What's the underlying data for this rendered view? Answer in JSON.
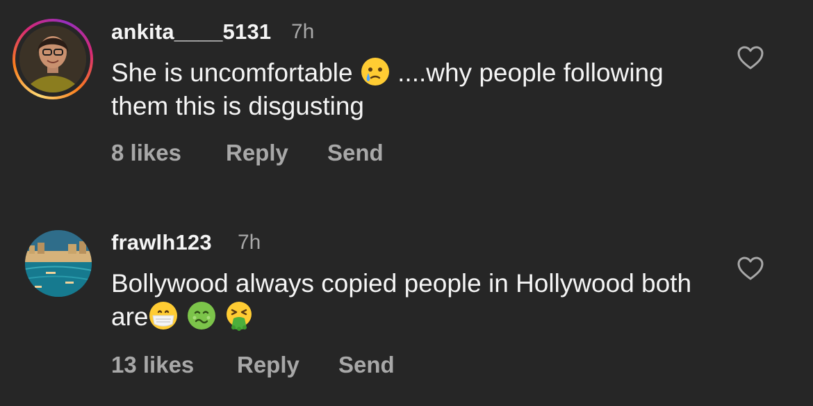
{
  "comments": [
    {
      "username": "ankita____5131",
      "time": "7h",
      "text_before": "She is uncomfortable ",
      "emoji_1": "face-holding-back-tears",
      "text_after": " ....why people following them this is disgusting",
      "likes": "8 likes",
      "reply": "Reply",
      "send": "Send",
      "has_story_ring": true
    },
    {
      "username": "frawlh123",
      "time": "7h",
      "text_before": "Bollywood always copied people in Hollywood both are",
      "emojis": [
        "face-with-medical-mask",
        "nauseated-face",
        "face-vomiting"
      ],
      "likes": "13 likes",
      "reply": "Reply",
      "send": "Send",
      "has_story_ring": false
    }
  ],
  "colors": {
    "background": "#262626",
    "primary_text": "#f5f5f5",
    "secondary_text": "#a8a8a8"
  },
  "icons": {
    "like": "heart-outline-icon"
  }
}
